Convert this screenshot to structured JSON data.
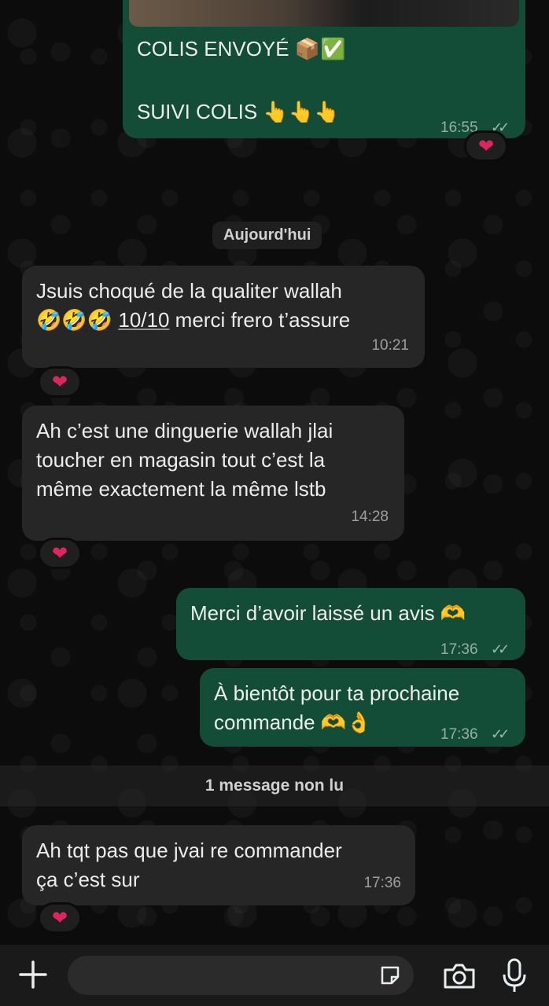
{
  "messages": {
    "m1": {
      "line1": "COLIS ENVOYÉ",
      "line1_emoji": "📦✅",
      "line2": "SUIVI COLIS",
      "line2_emoji": "👆👆👆",
      "time": "16:55"
    },
    "date_separator": "Aujourd'hui",
    "m2": {
      "line1": "Jsuis choqué de la qualiter wallah",
      "line2_emoji": "🤣🤣🤣",
      "line2_score": "10/10",
      "line2_rest": " merci frero t’assure",
      "time": "10:21"
    },
    "m3": {
      "line1": "Ah c’est une dinguerie wallah jlai",
      "line2": "toucher en magasin tout c’est la",
      "line3": "même exactement la même lstb",
      "time": "14:28"
    },
    "m4": {
      "text": "Merci d’avoir laissé un avis",
      "emoji": "🫶",
      "time": "17:36"
    },
    "m5": {
      "line1": "À bientôt pour ta prochaine",
      "line2": "commande",
      "emoji": "🫶👌",
      "time": "17:36"
    },
    "unread_label": "1 message non lu",
    "m6": {
      "line1": "Ah tqt pas que jvai re commander",
      "line2": "ça c’est sur",
      "time": "17:36"
    }
  },
  "reaction_emoji": "❤",
  "ticks": "✓✓",
  "composer": {
    "plus_icon": "plus-icon",
    "sticker_icon": "sticker-icon",
    "camera_icon": "camera-icon",
    "mic_icon": "microphone-icon"
  },
  "colors": {
    "incoming": "#262626",
    "outgoing": "#134d37",
    "heart": "#e0245e"
  }
}
